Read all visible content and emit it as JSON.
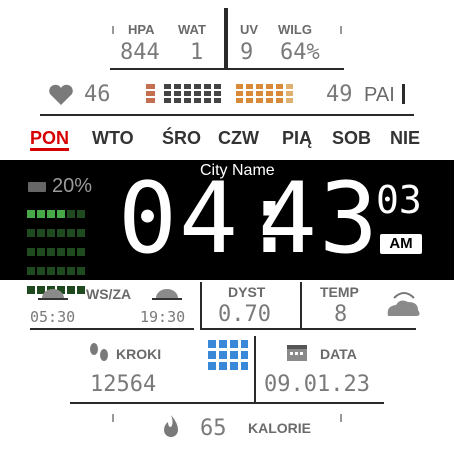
{
  "top_stats": [
    {
      "label": "HPA",
      "value": "844"
    },
    {
      "label": "WAT",
      "value": "1"
    },
    {
      "label": "UV",
      "value": "9"
    },
    {
      "label": "WILG",
      "value": "64%"
    }
  ],
  "heart": {
    "icon": "heart-icon",
    "value": "46"
  },
  "pai": {
    "value": "49",
    "label": "PAI"
  },
  "days": [
    {
      "label": "PON",
      "active": true
    },
    {
      "label": "WTO"
    },
    {
      "label": "ŚRO"
    },
    {
      "label": "CZW"
    },
    {
      "label": "PIĄ"
    },
    {
      "label": "SOB"
    },
    {
      "label": "NIE"
    }
  ],
  "city": "City Name",
  "battery": {
    "percent": "20%"
  },
  "time": {
    "hours": "04",
    "minutes": "43",
    "seconds": "03",
    "ampm": "AM"
  },
  "sun": {
    "label": "WS/ZA",
    "sunrise": "05:30",
    "sunset": "19:30"
  },
  "distance": {
    "label": "DYST",
    "value": "0.70"
  },
  "temperature": {
    "label": "TEMP",
    "value": "8",
    "icon": "cloud-icon"
  },
  "steps": {
    "label": "KROKI",
    "value": "12564",
    "icon": "footsteps-icon"
  },
  "date": {
    "label": "DATA",
    "value": "09.01.23",
    "icon": "calendar-icon"
  },
  "calories": {
    "value": "65",
    "label": "KALORIE",
    "icon": "flame-icon"
  },
  "colors": {
    "accent": "#d60000",
    "battery_green": "#47a847",
    "background_band": "#000000"
  }
}
